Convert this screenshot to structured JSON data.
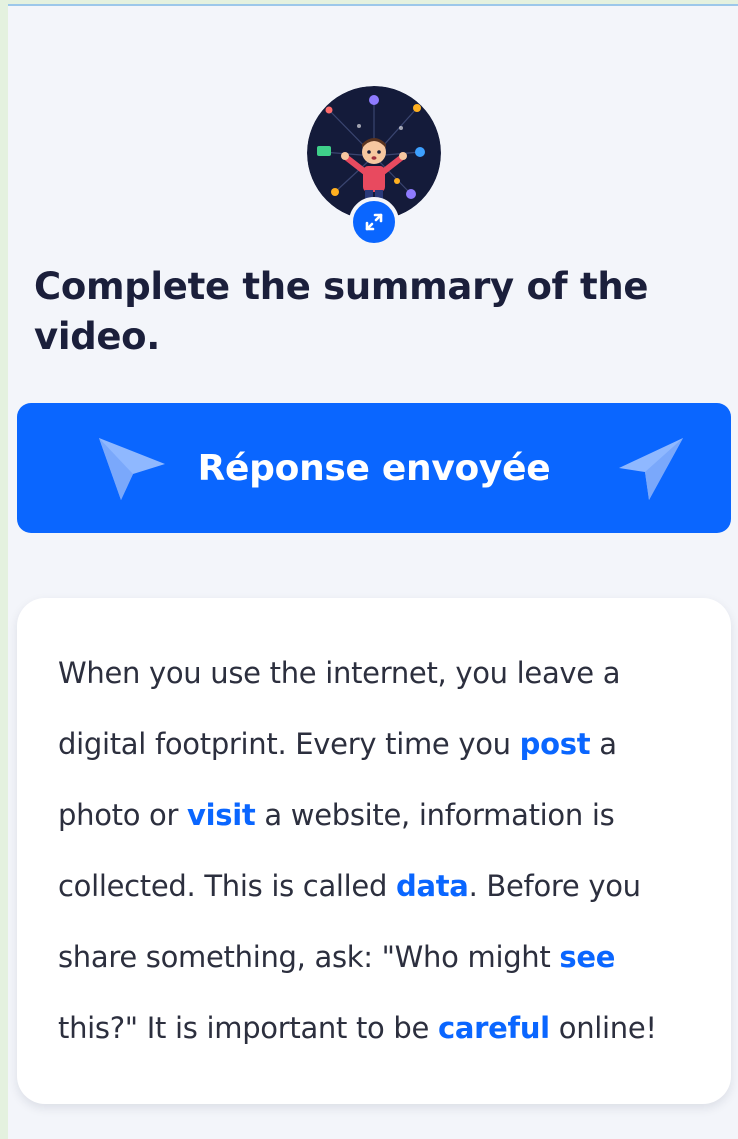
{
  "question": {
    "title": "Complete the summary of the video."
  },
  "submit": {
    "label": "Réponse envoyée"
  },
  "summary": {
    "s1": "When you use the internet, you leave a digital footprint. Every time you ",
    "b1": "post",
    "s2": " a photo or ",
    "b2": "visit",
    "s3": " a website, information is collected. This is called ",
    "b3": "data",
    "s4": ". Before you share something, ask: \"Who might ",
    "b4": "see",
    "s5": " this?\" It is important to be ",
    "b5": "careful",
    "s6": " online!"
  },
  "icons": {
    "expand": "expand-arrows-icon",
    "send_left": "paper-plane-icon",
    "send_right": "paper-plane-icon"
  },
  "colors": {
    "accent": "#0a66ff",
    "heading": "#1b1f3b",
    "body_text": "#2c2f3e",
    "background": "#f3f5fa",
    "card": "#ffffff",
    "plane_tint": "#8fb8ff"
  }
}
